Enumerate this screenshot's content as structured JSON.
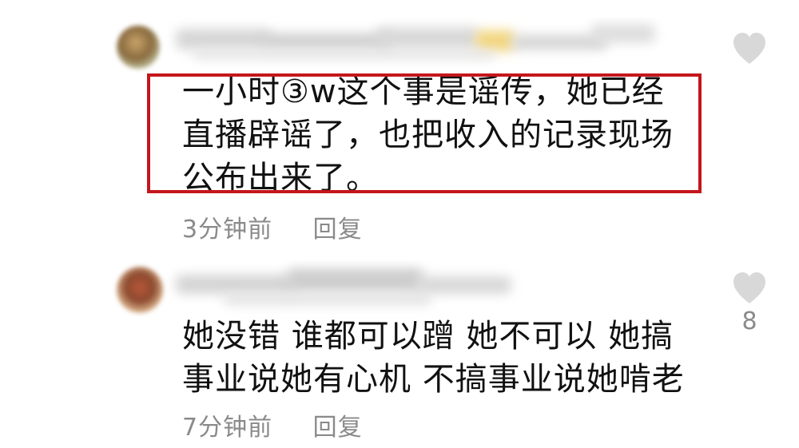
{
  "comments": [
    {
      "text": "一小时③w这个事是谣传，她已经直播辟谣了，也把收入的记录现场公布出来了。",
      "time": "3分钟前",
      "reply_label": "回复",
      "like_count": "",
      "highlighted": true,
      "highlight_color": "#c4161c"
    },
    {
      "text": "她没错 谁都可以蹭 她不可以 她搞事业说她有心机 不搞事业说她啃老",
      "time": "7分钟前",
      "reply_label": "回复",
      "like_count": "8",
      "highlighted": false
    }
  ],
  "colors": {
    "text": "#111111",
    "meta": "#8a8a8a",
    "heart": "#d8d8d8"
  },
  "icons": {
    "like": "heart-icon"
  }
}
